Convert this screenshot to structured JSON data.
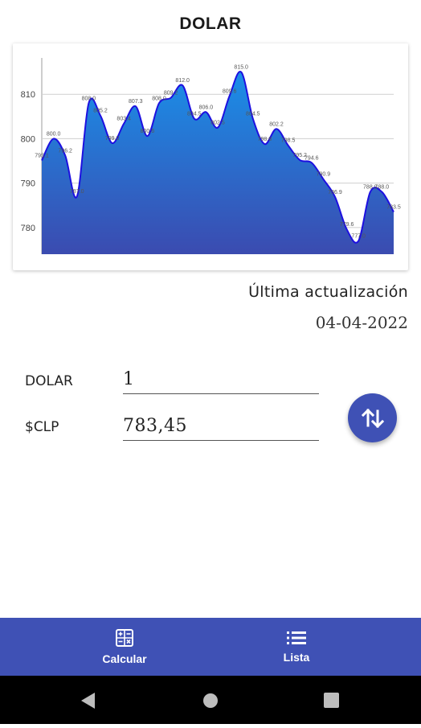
{
  "header": {
    "title": "DOLAR"
  },
  "chart_data": {
    "type": "area",
    "y_ticks": [
      "810",
      "800",
      "790",
      "780"
    ],
    "ylim": [
      774,
      820
    ],
    "grid": true,
    "fill_colors": [
      "#1a8fe8",
      "#3b4bb0"
    ],
    "line_color": "#1d10e0",
    "values": [
      795.1,
      800.0,
      796.2,
      787.0,
      808.0,
      805.2,
      799.0,
      803.4,
      807.3,
      800.6,
      808.0,
      809.2,
      812.0,
      804.5,
      806.0,
      802.5,
      809.6,
      815.0,
      804.5,
      798.8,
      802.2,
      798.5,
      795.2,
      794.6,
      790.9,
      786.9,
      779.6,
      777.0,
      788.0,
      788.0,
      783.5
    ],
    "labels": [
      "795.1",
      "800.0",
      "796.2",
      "787.0",
      "808.0",
      "805.2",
      "799.0",
      "803.4",
      "807.3",
      "800.6",
      "808.0",
      "809.2",
      "812.0",
      "804.5",
      "806.0",
      "802.5",
      "809.6",
      "815.0",
      "804.5",
      "798.8",
      "802.2",
      "798.5",
      "795.2",
      "794.6",
      "790.9",
      "786.9",
      "779.6",
      "777.0",
      "788.0",
      "788.0",
      "783.5"
    ]
  },
  "update": {
    "label": "Última actualización",
    "date": "04-04-2022"
  },
  "converter": {
    "from_label": "DOLAR",
    "from_value": "1",
    "to_label": "$CLP",
    "to_value": "783,45",
    "swap_icon": "swap-vertical-icon"
  },
  "nav": {
    "items": [
      {
        "label": "Calcular",
        "icon": "calculator-icon"
      },
      {
        "label": "Lista",
        "icon": "list-icon"
      }
    ],
    "color": "#3f51b5"
  },
  "system_bar": {
    "icons": [
      "back-icon",
      "home-icon",
      "recents-icon"
    ]
  }
}
